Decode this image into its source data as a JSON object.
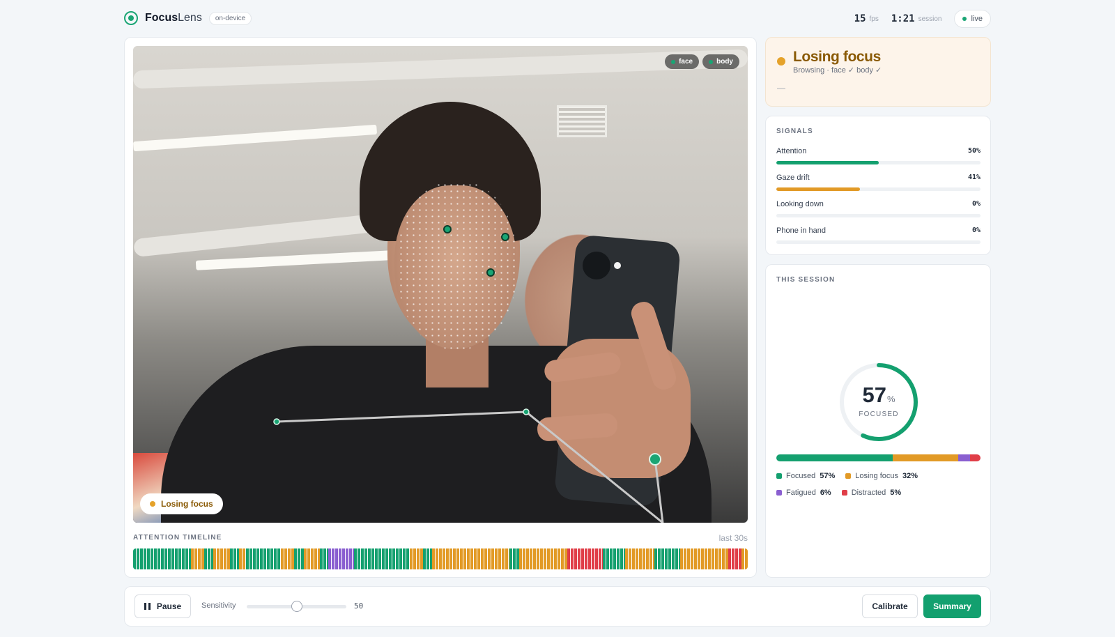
{
  "app": {
    "logo_icon": "target-icon",
    "name_bold": "Focus",
    "name_light": "Lens",
    "mode_badge": "on-device"
  },
  "header_stats": {
    "fps_value": "15",
    "fps_unit": "fps",
    "session_value": "1:21",
    "session_unit": "session",
    "live_label": "live"
  },
  "video": {
    "overlay_chips": [
      {
        "label": "face"
      },
      {
        "label": "body"
      }
    ],
    "state_pill": "Losing focus",
    "timeline_title": "ATTENTION TIMELINE",
    "timeline_range": "last 30s"
  },
  "colors": {
    "focused": "#14a06f",
    "losing": "#e29a26",
    "fatigued": "#8a5fd0",
    "distracted": "#e03e48",
    "accent": "#13a06f",
    "status_text": "#8a5a05"
  },
  "timeline_segments": [
    [
      "focused",
      9
    ],
    [
      "losing",
      2
    ],
    [
      "focused",
      1.5
    ],
    [
      "losing",
      2.5
    ],
    [
      "focused",
      1.5
    ],
    [
      "losing",
      1
    ],
    [
      "focused",
      5.5
    ],
    [
      "losing",
      2
    ],
    [
      "focused",
      1.5
    ],
    [
      "losing",
      2.5
    ],
    [
      "focused",
      1.3
    ],
    [
      "fatigued",
      4
    ],
    [
      "focused",
      8.7
    ],
    [
      "losing",
      2
    ],
    [
      "focused",
      1.5
    ],
    [
      "losing",
      12
    ],
    [
      "focused",
      1.5
    ],
    [
      "losing",
      7.5
    ],
    [
      "distracted",
      5.5
    ],
    [
      "focused",
      3.5
    ],
    [
      "losing",
      4.5
    ],
    [
      "focused",
      4
    ],
    [
      "losing",
      7.5
    ],
    [
      "distracted",
      2
    ],
    [
      "losing",
      1
    ]
  ],
  "status": {
    "title": "Losing focus",
    "subtitle": "Browsing · face ✓ body ✓",
    "note": "—"
  },
  "signals": {
    "label": "SIGNALS",
    "items": [
      {
        "name": "Attention",
        "value": "50%",
        "level": 0.5,
        "color": "#14a06f"
      },
      {
        "name": "Gaze drift",
        "value": "41%",
        "level": 0.41,
        "color": "#e29a26"
      },
      {
        "name": "Looking down",
        "value": "0%",
        "level": 0,
        "color": "#14a06f"
      },
      {
        "name": "Phone in hand",
        "value": "0%",
        "level": 0,
        "color": "#14a06f"
      }
    ]
  },
  "session": {
    "label": "THIS SESSION",
    "focused_value": "57",
    "focused_unit": "%",
    "focused_caption": "FOCUSED",
    "focused_fraction": 0.57,
    "breakdown": [
      {
        "key": "focused",
        "name": "Focused",
        "value": "57%",
        "fraction": 0.57
      },
      {
        "key": "losing",
        "name": "Losing focus",
        "value": "32%",
        "fraction": 0.32
      },
      {
        "key": "fatigued",
        "name": "Fatigued",
        "value": "6%",
        "fraction": 0.06
      },
      {
        "key": "distracted",
        "name": "Distracted",
        "value": "5%",
        "fraction": 0.05
      }
    ]
  },
  "controls": {
    "pause_label": "Pause",
    "sensitivity_label": "Sensitivity",
    "sensitivity_value": "50",
    "sensitivity_level": 0.5,
    "calibrate_label": "Calibrate",
    "summary_label": "Summary"
  }
}
